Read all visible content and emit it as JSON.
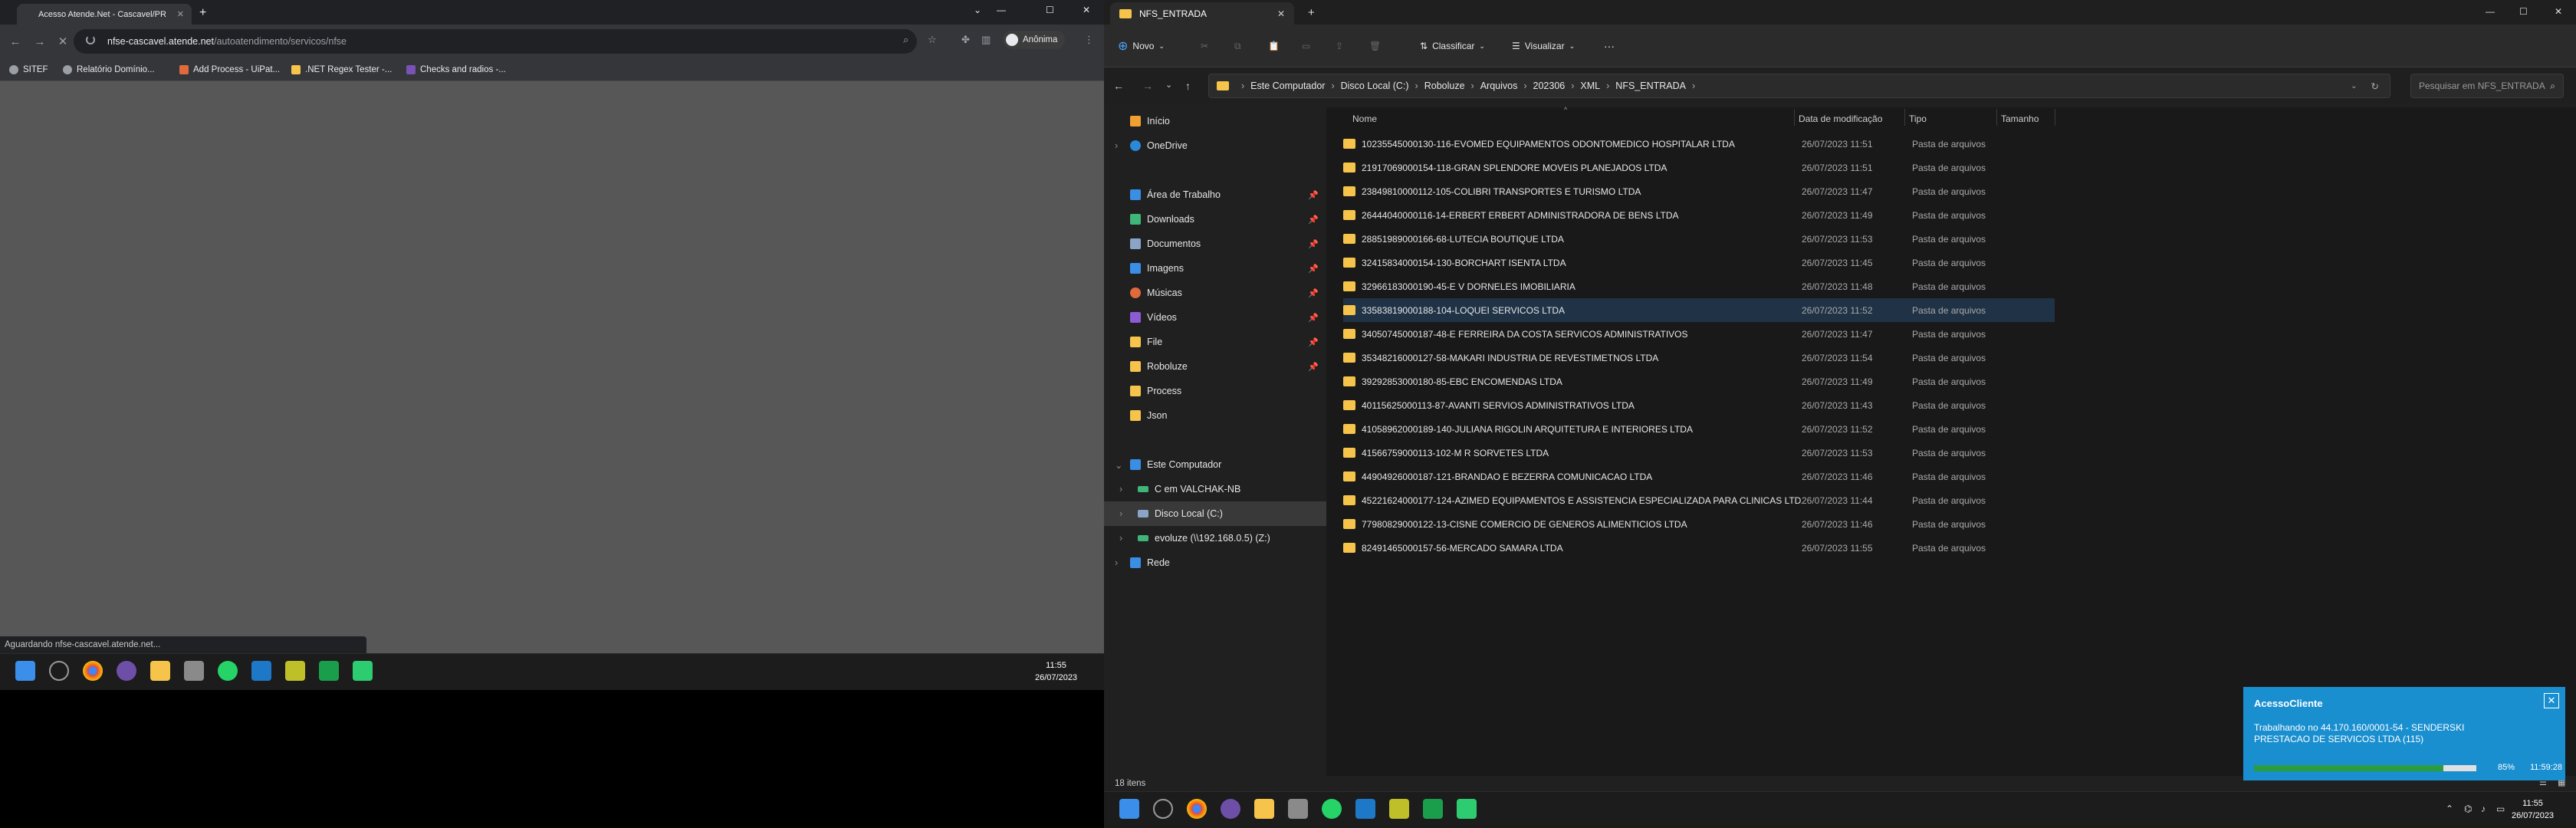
{
  "chrome": {
    "tab_title": "Acesso Atende.Net - Cascavel/PR",
    "new_tab": "+",
    "url_host": "nfse-cascavel.atende.net",
    "url_path": "/autoatendimento/servicos/nfse",
    "profile": "Anônima",
    "bookmarks": [
      "SITEF",
      "Relatório Domínio...",
      "Add Process - UiPat...",
      ".NET Regex Tester -...",
      "Checks and radios -..."
    ],
    "status": "Aguardando nfse-cascavel.atende.net...",
    "window_controls": {
      "min": "—",
      "max": "☐",
      "close": "✕"
    }
  },
  "taskbar_left": {
    "time": "11:55",
    "date": "26/07/2023"
  },
  "explorer": {
    "tab_title": "NFS_ENTRADA",
    "toolbar": {
      "new": "Novo",
      "sort": "Classificar",
      "view": "Visualizar",
      "more": "···"
    },
    "breadcrumb": [
      "Este Computador",
      "Disco Local (C:)",
      "Roboluze",
      "Arquivos",
      "202306",
      "XML",
      "NFS_ENTRADA"
    ],
    "search_placeholder": "Pesquisar em NFS_ENTRADA",
    "nav": [
      {
        "label": "Início",
        "color": "#f0a030"
      },
      {
        "label": "OneDrive",
        "color": "#2b88d8"
      },
      {
        "label": "Área de Trabalho",
        "color": "#3a8ee6",
        "pin": true
      },
      {
        "label": "Downloads",
        "color": "#3fb57a",
        "pin": true
      },
      {
        "label": "Documentos",
        "color": "#8aa4c8",
        "pin": true
      },
      {
        "label": "Imagens",
        "color": "#3a8ee6",
        "pin": true
      },
      {
        "label": "Músicas",
        "color": "#e06a3b",
        "pin": true
      },
      {
        "label": "Vídeos",
        "color": "#8e5bd6",
        "pin": true
      },
      {
        "label": "File",
        "color": "#f7c44b",
        "pin": true
      },
      {
        "label": "Roboluze",
        "color": "#f7c44b",
        "pin": true
      },
      {
        "label": "Process",
        "color": "#f7c44b"
      },
      {
        "label": "Json",
        "color": "#f7c44b"
      },
      {
        "label": "Este Computador",
        "color": "#3a8ee6"
      },
      {
        "label": "C em VALCHAK-NB",
        "color": "#3fb57a"
      },
      {
        "label": "Disco Local (C:)",
        "color": "#8aa4c8"
      },
      {
        "label": "evoluze (\\\\192.168.0.5) (Z:)",
        "color": "#3fb57a"
      },
      {
        "label": "Rede",
        "color": "#3a8ee6"
      }
    ],
    "columns": {
      "name": "Nome",
      "date": "Data de modificação",
      "type": "Tipo",
      "size": "Tamanho"
    },
    "files": [
      {
        "name": "10235545000130-116-EVOMED EQUIPAMENTOS ODONTOMEDICO HOSPITALAR LTDA",
        "date": "26/07/2023 11:51",
        "type": "Pasta de arquivos"
      },
      {
        "name": "21917069000154-118-GRAN SPLENDORE MOVEIS PLANEJADOS LTDA",
        "date": "26/07/2023 11:51",
        "type": "Pasta de arquivos"
      },
      {
        "name": "23849810000112-105-COLIBRI TRANSPORTES E TURISMO LTDA",
        "date": "26/07/2023 11:47",
        "type": "Pasta de arquivos"
      },
      {
        "name": "26444040000116-14-ERBERT ERBERT ADMINISTRADORA DE BENS LTDA",
        "date": "26/07/2023 11:49",
        "type": "Pasta de arquivos"
      },
      {
        "name": "28851989000166-68-LUTECIA BOUTIQUE LTDA",
        "date": "26/07/2023 11:53",
        "type": "Pasta de arquivos"
      },
      {
        "name": "32415834000154-130-BORCHART ISENTA LTDA",
        "date": "26/07/2023 11:45",
        "type": "Pasta de arquivos"
      },
      {
        "name": "32966183000190-45-E V DORNELES IMOBILIARIA",
        "date": "26/07/2023 11:48",
        "type": "Pasta de arquivos"
      },
      {
        "name": "33583819000188-104-LOQUEI SERVICOS LTDA",
        "date": "26/07/2023 11:52",
        "type": "Pasta de arquivos"
      },
      {
        "name": "34050745000187-48-E FERREIRA DA COSTA SERVICOS ADMINISTRATIVOS",
        "date": "26/07/2023 11:47",
        "type": "Pasta de arquivos"
      },
      {
        "name": "35348216000127-58-MAKARI INDUSTRIA DE REVESTIMETNOS LTDA",
        "date": "26/07/2023 11:54",
        "type": "Pasta de arquivos"
      },
      {
        "name": "39292853000180-85-EBC ENCOMENDAS LTDA",
        "date": "26/07/2023 11:49",
        "type": "Pasta de arquivos"
      },
      {
        "name": "40115625000113-87-AVANTI SERVIOS ADMINISTRATIVOS LTDA",
        "date": "26/07/2023 11:43",
        "type": "Pasta de arquivos"
      },
      {
        "name": "41058962000189-140-JULIANA RIGOLIN ARQUITETURA E INTERIORES LTDA",
        "date": "26/07/2023 11:52",
        "type": "Pasta de arquivos"
      },
      {
        "name": "41566759000113-102-M R SORVETES LTDA",
        "date": "26/07/2023 11:53",
        "type": "Pasta de arquivos"
      },
      {
        "name": "44904926000187-121-BRANDAO E BEZERRA COMUNICACAO LTDA",
        "date": "26/07/2023 11:46",
        "type": "Pasta de arquivos"
      },
      {
        "name": "45221624000177-124-AZIMED EQUIPAMENTOS E ASSISTENCIA ESPECIALIZADA PARA CLINICAS LTDA",
        "date": "26/07/2023 11:44",
        "type": "Pasta de arquivos"
      },
      {
        "name": "77980829000122-13-CISNE COMERCIO DE GENEROS ALIMENTICIOS LTDA",
        "date": "26/07/2023 11:46",
        "type": "Pasta de arquivos"
      },
      {
        "name": "82491465000157-56-MERCADO SAMARA LTDA",
        "date": "26/07/2023 11:55",
        "type": "Pasta de arquivos"
      }
    ],
    "status": "18 itens"
  },
  "notification": {
    "title": "AcessoCliente",
    "message": "Trabalhando no 44.170.160/0001-54 - SENDERSKI PRESTACAO DE SERVICOS LTDA (115)",
    "progress_label": "85%",
    "progress": 0.85,
    "time": "11:59:28"
  },
  "taskbar_right": {
    "time": "11:55",
    "date": "26/07/2023"
  }
}
